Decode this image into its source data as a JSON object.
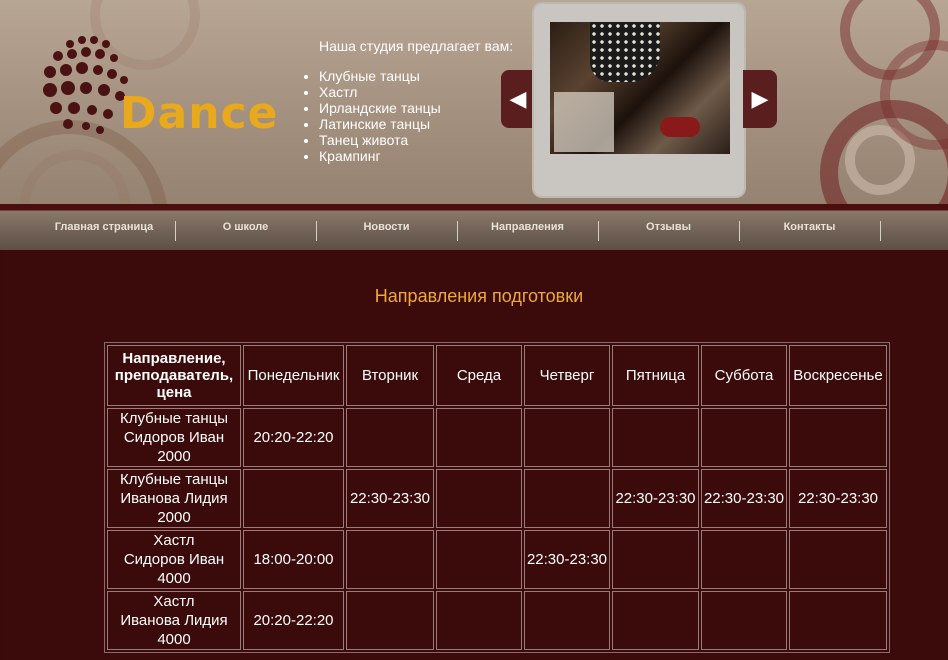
{
  "logo": {
    "text": "Dance"
  },
  "offer": {
    "title": "Наша студия предлагает вам:",
    "items": [
      "Клубные танцы",
      "Хастл",
      "Ирландские танцы",
      "Латинские танцы",
      "Танец живота",
      "Крампинг"
    ]
  },
  "slider": {
    "prev_icon": "chevron-left-icon",
    "next_icon": "chevron-right-icon",
    "prev_glyph": "◀",
    "next_glyph": "▶"
  },
  "nav": {
    "items": [
      "Главная страница",
      "О школе",
      "Новости",
      "Направления",
      "Отзывы",
      "Контакты"
    ]
  },
  "page_title": "Направления подготовки",
  "table": {
    "headers": [
      "Направление, преподаватель, цена",
      "Понедельник",
      "Вторник",
      "Среда",
      "Четверг",
      "Пятница",
      "Суббота",
      "Воскресенье"
    ],
    "rows": [
      {
        "direction": "Клубные танцы",
        "teacher": "Сидоров Иван",
        "price": "2000",
        "cells": [
          "20:20-22:20",
          "",
          "",
          "",
          "",
          "",
          ""
        ]
      },
      {
        "direction": "Клубные танцы",
        "teacher": "Иванова Лидия",
        "price": "2000",
        "cells": [
          "",
          "22:30-23:30",
          "",
          "",
          "22:30-23:30",
          "22:30-23:30",
          "22:30-23:30"
        ]
      },
      {
        "direction": "Хастл",
        "teacher": "Сидоров Иван",
        "price": "4000",
        "cells": [
          "18:00-20:00",
          "",
          "",
          "22:30-23:30",
          "",
          "",
          ""
        ]
      },
      {
        "direction": "Хастл",
        "teacher": "Иванова Лидия",
        "price": "4000",
        "cells": [
          "20:20-22:20",
          "",
          "",
          "",
          "",
          "",
          ""
        ]
      }
    ]
  },
  "colors": {
    "accent": "#e8a91c",
    "title": "#eda93a",
    "background": "#3b0a0a",
    "nav_text": "#e9e2d9"
  }
}
